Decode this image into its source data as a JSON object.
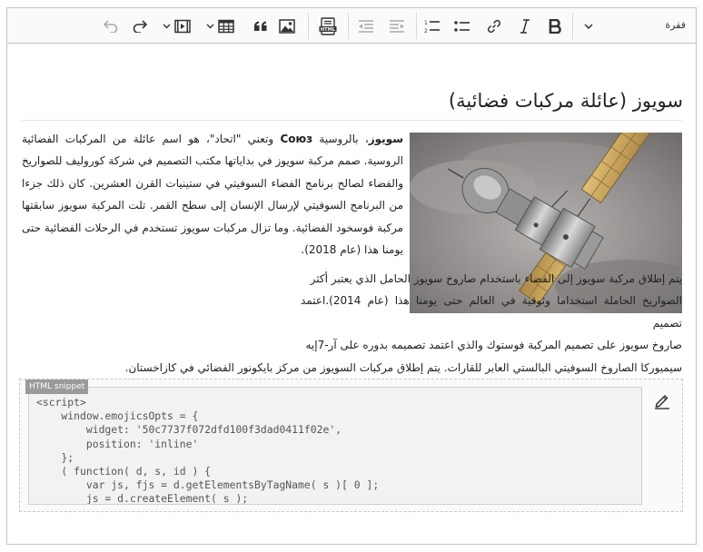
{
  "toolbar": {
    "paragraph_label": "فقرة",
    "icons": [
      "undo-icon",
      "redo-icon",
      "media-embed-icon",
      "table-icon",
      "blockquote-icon",
      "image-icon",
      "html-embed-icon",
      "outdent-icon",
      "indent-icon",
      "numbered-list-icon",
      "bulleted-list-icon",
      "link-icon",
      "italic-icon",
      "bold-icon",
      "chevron-down-icon"
    ],
    "html_icon_text": "HTML"
  },
  "document": {
    "title": "سويوز (عائلة مركبات فضائية)",
    "image_alt": "Soyuz spacecraft in orbit",
    "para1": {
      "bold": "سويوز",
      "part1": "، بالروسية ",
      "bold_ru": "Союз",
      "part2": " وتعني \"اتحاد\"، هو اسم عائلة من المركبات الفضائية الروسية. صمم مركبة سويوز في بداياتها مكتب التصميم في شركة كوروليف للصواريخ والفضاء لصالح برنامج الفضاء السوفيتي في ستينيات القرن العشرين. كان ذلك جزءا من البرنامج السوفيتي لإرسال الإنسان إلى سطح القمر. تلت المركبة سويوز سابقتها مركبة فوسخود الفضائية. وما تزال مركبات سويوز تستخدم في الرحلات الفضائية حتى يومنا هذا (عام 2018)."
    },
    "para2": {
      "line1": "يتم إطلاق مركبة سويوز إلى الفضاء باستخدام صاروخ سويوز الحامل الذي يعتبر أكثر",
      "line2": "الصواريخ الحاملة استخداما وثوقية في العالم حتى يومنا هذا (عام 2014).اعتمد تصميم",
      "line3": "صاروخ سويوز على تصميم المركبة فوستوك والذي اعتمد تصميمه بدوره على آر-7إيه",
      "line4": "سيميوركا الصاروخ السوفيتي البالستي العابر للقارات. يتم إطلاق مركبات السويوز من مركز بايكونور الفضائي في كازاخستان."
    }
  },
  "html_snippet": {
    "label": "HTML snippet",
    "code": "<script>\n    window.emojicsOpts = {\n        widget: '50c7737f072dfd100f3dad0411f02e',\n        position: 'inline'\n    };\n    ( function( d, s, id ) {\n        var js, fjs = d.getElementsByTagName( s )[ 0 ];\n        js = d.createElement( s );"
  }
}
